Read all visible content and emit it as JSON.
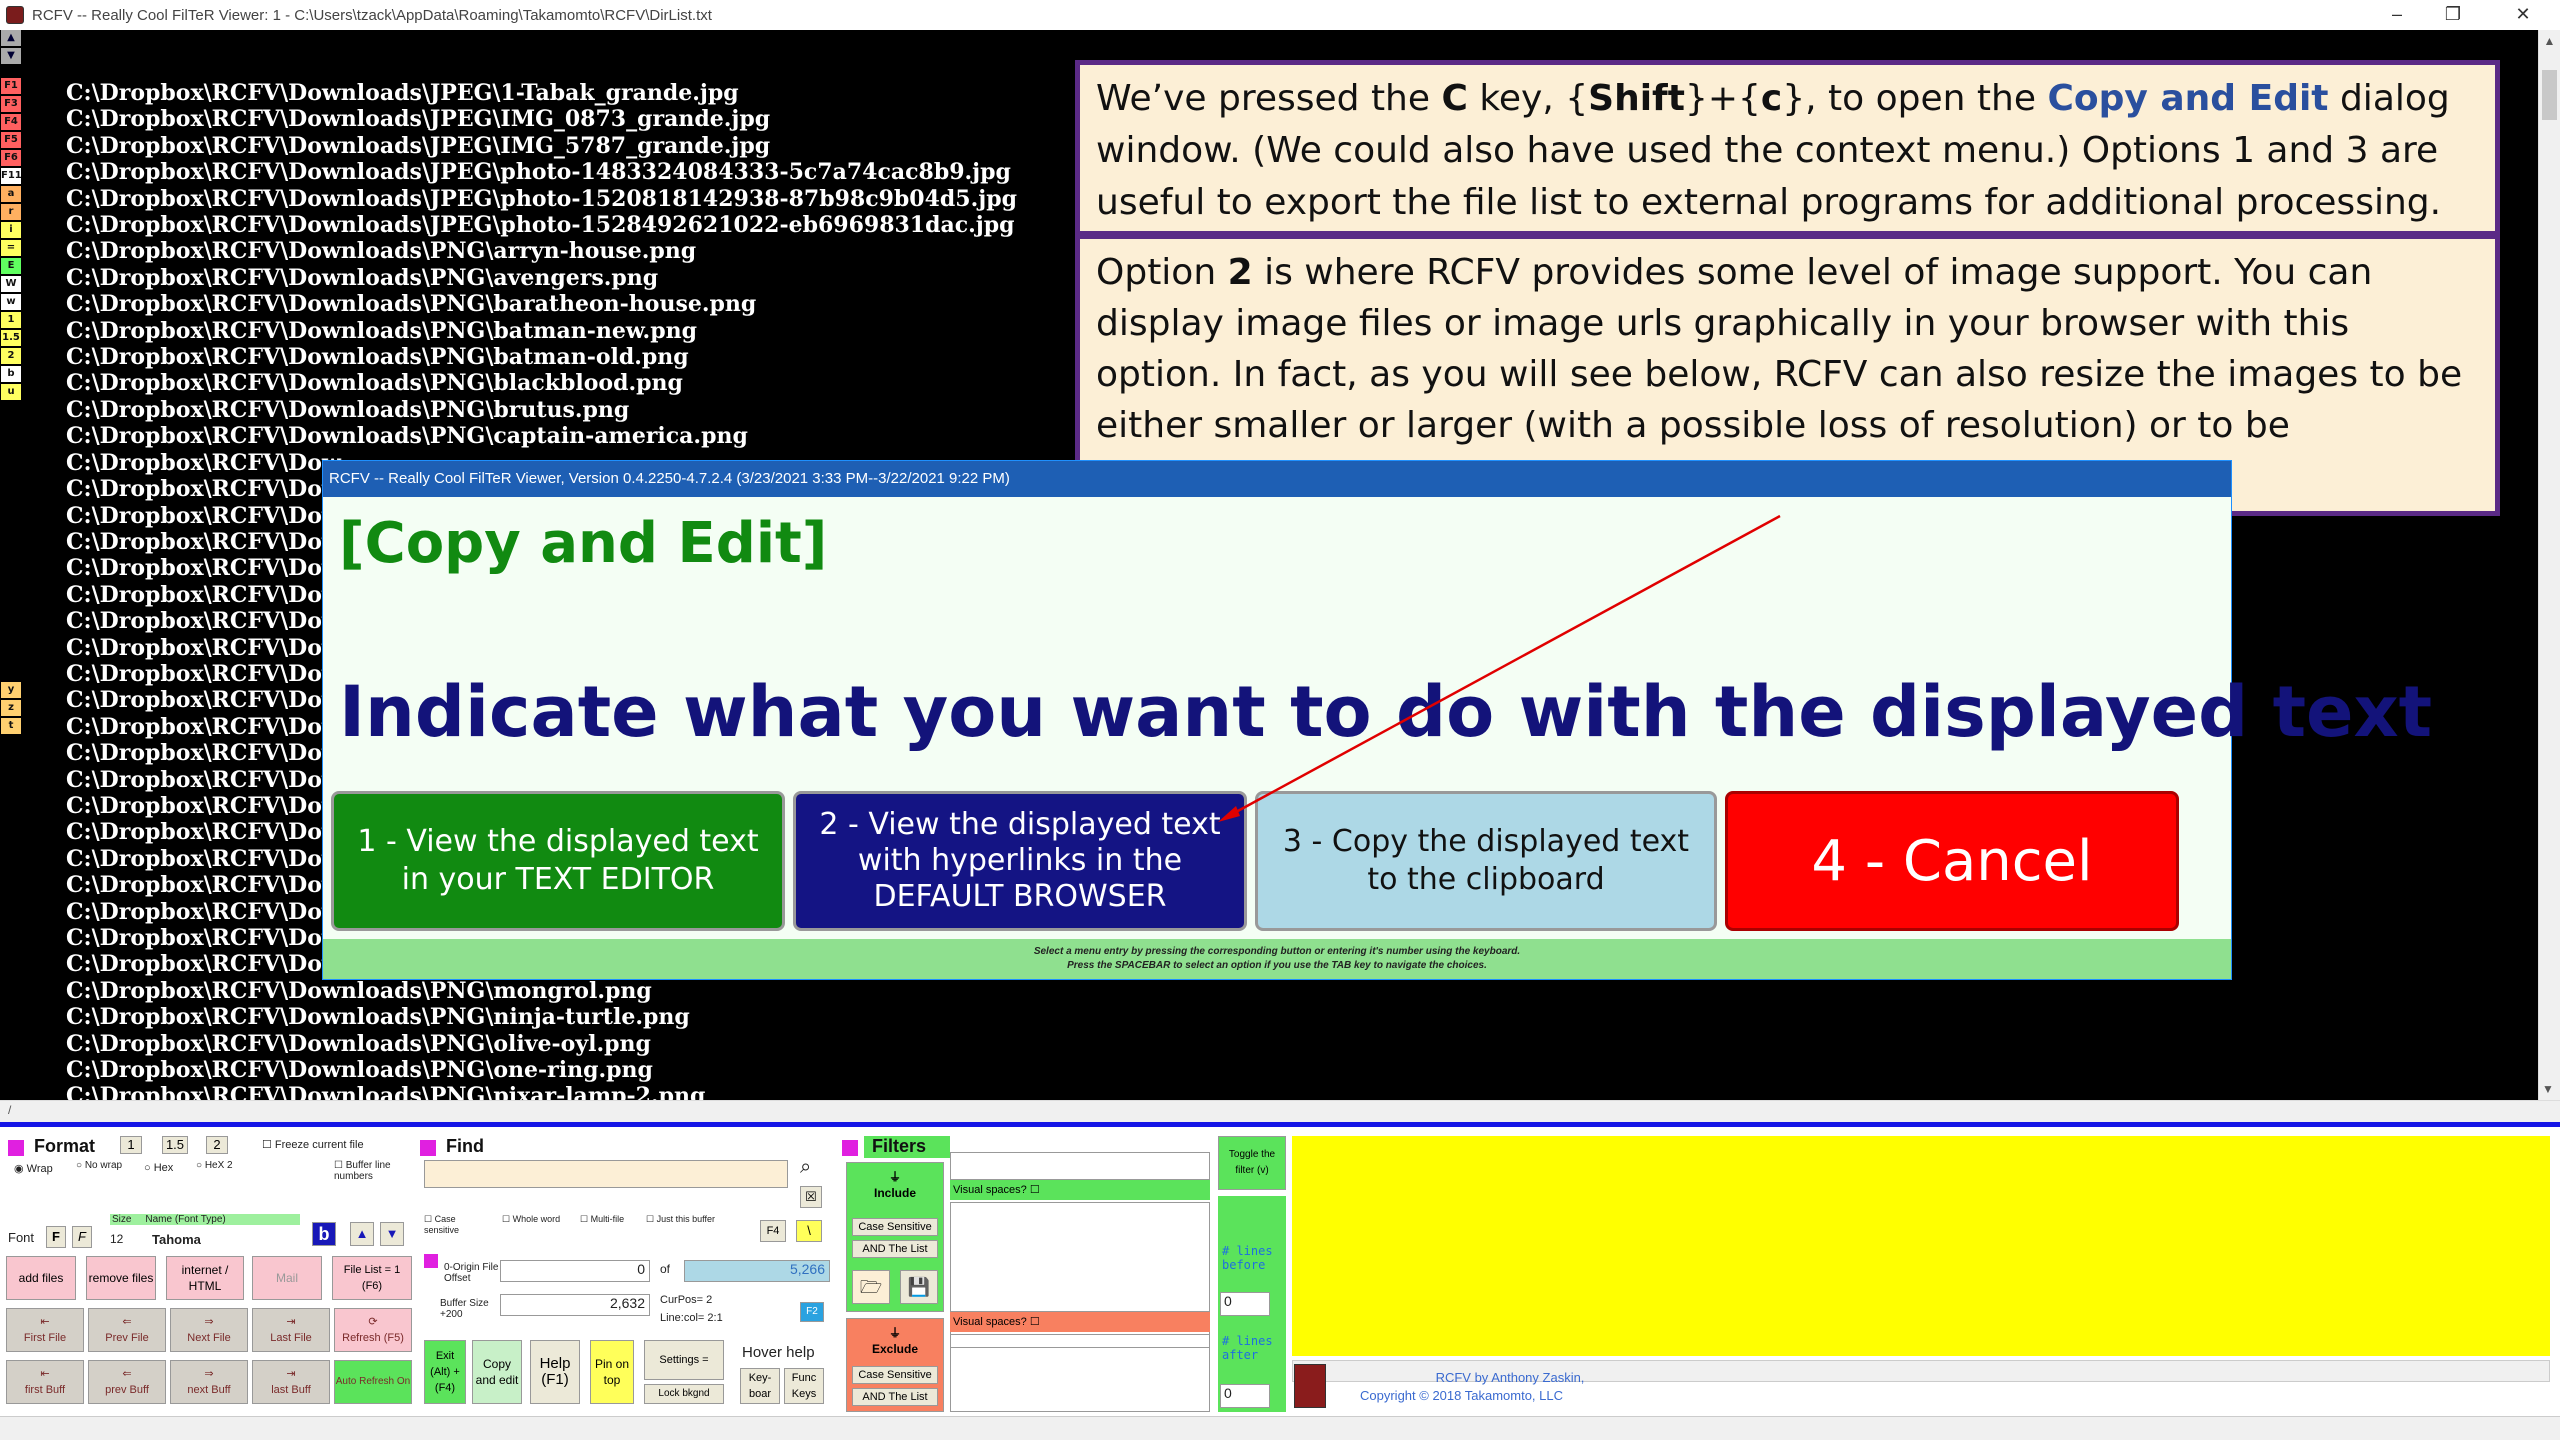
{
  "window": {
    "title": "RCFV -- Really Cool FilTeR Viewer: 1 - C:\\Users\\tzack\\AppData\\Roaming\\Takamomto\\RCFV\\DirList.txt",
    "minimize": "–",
    "restore": "❐",
    "close": "✕"
  },
  "gutter": {
    "marks": [
      {
        "label": "F1",
        "color": "#ff6060"
      },
      {
        "label": "F3",
        "color": "#ff6060"
      },
      {
        "label": "F4",
        "color": "#ff6060"
      },
      {
        "label": "F5",
        "color": "#ff6060"
      },
      {
        "label": "F6",
        "color": "#ff6060"
      },
      {
        "label": "F11",
        "color": "#ffffff"
      },
      {
        "label": "a",
        "color": "#ffb060"
      },
      {
        "label": "r",
        "color": "#ffb060"
      },
      {
        "label": "i",
        "color": "#ffff60"
      },
      {
        "label": "=",
        "color": "#ffff60"
      },
      {
        "label": "E",
        "color": "#60ff60"
      },
      {
        "label": "W",
        "color": "#ffffff"
      },
      {
        "label": "w",
        "color": "#ffffff"
      },
      {
        "label": "1",
        "color": "#ffff60"
      },
      {
        "label": "1.5",
        "color": "#ffff60"
      },
      {
        "label": "2",
        "color": "#ffff60"
      },
      {
        "label": "b",
        "color": "#ffffff"
      },
      {
        "label": "u",
        "color": "#ffff60"
      }
    ],
    "lower_marks": [
      "y",
      "z",
      "t"
    ]
  },
  "lines": [
    "C:\\Dropbox\\RCFV\\Downloads\\JPEG\\1-Tabak_grande.jpg",
    "C:\\Dropbox\\RCFV\\Downloads\\JPEG\\IMG_0873_grande.jpg",
    "C:\\Dropbox\\RCFV\\Downloads\\JPEG\\IMG_5787_grande.jpg",
    "C:\\Dropbox\\RCFV\\Downloads\\JPEG\\photo-1483324084333-5c7a74cac8b9.jpg",
    "C:\\Dropbox\\RCFV\\Downloads\\JPEG\\photo-1520818142938-87b98c9b04d5.jpg",
    "C:\\Dropbox\\RCFV\\Downloads\\JPEG\\photo-1528492621022-eb6969831dac.jpg",
    "C:\\Dropbox\\RCFV\\Downloads\\PNG\\arryn-house.png",
    "C:\\Dropbox\\RCFV\\Downloads\\PNG\\avengers.png",
    "C:\\Dropbox\\RCFV\\Downloads\\PNG\\baratheon-house.png",
    "C:\\Dropbox\\RCFV\\Downloads\\PNG\\batman-new.png",
    "C:\\Dropbox\\RCFV\\Downloads\\PNG\\batman-old.png",
    "C:\\Dropbox\\RCFV\\Downloads\\PNG\\blackblood.png",
    "C:\\Dropbox\\RCFV\\Downloads\\PNG\\brutus.png",
    "C:\\Dropbox\\RCFV\\Downloads\\PNG\\captain-america.png",
    "C:\\Dropbox\\RCFV\\Dow",
    "C:\\Dropbox\\RCFV\\Dow",
    "C:\\Dropbox\\RCFV\\Dow",
    "C:\\Dropbox\\RCFV\\Dow",
    "C:\\Dropbox\\RCFV\\Dow",
    "C:\\Dropbox\\RCFV\\Dow",
    "C:\\Dropbox\\RCFV\\Dow",
    "C:\\Dropbox\\RCFV\\Dow",
    "C:\\Dropbox\\RCFV\\Dow",
    "C:\\Dropbox\\RCFV\\Dow",
    "C:\\Dropbox\\RCFV\\Dow",
    "C:\\Dropbox\\RCFV\\Dow",
    "C:\\Dropbox\\RCFV\\Dow",
    "C:\\Dropbox\\RCFV\\Dow",
    "C:\\Dropbox\\RCFV\\Dow",
    "C:\\Dropbox\\RCFV\\Dow",
    "C:\\Dropbox\\RCFV\\Dow",
    "C:\\Dropbox\\RCFV\\Dow",
    "C:\\Dropbox\\RCFV\\Dow",
    "C:\\Dropbox\\RCFV\\Dow",
    "C:\\Dropbox\\RCFV\\Downloads\\PNG\\mongrol.png",
    "C:\\Dropbox\\RCFV\\Downloads\\PNG\\ninja-turtle.png",
    "C:\\Dropbox\\RCFV\\Downloads\\PNG\\olive-oyl.png",
    "C:\\Dropbox\\RCFV\\Downloads\\PNG\\one-ring.png",
    "C:\\Dropbox\\RCFV\\Downloads\\PNG\\pixar-lamp-2.png"
  ],
  "callout1": {
    "p1": "We’ve pressed the ",
    "k1": "C",
    "p2": " key, {",
    "k2": "Shift",
    "p3": "}+{",
    "k3": "c",
    "p4": "}, to open the ",
    "link": "Copy and Edit",
    "p5": " dialog window. (We could also have used the context menu.)  Options 1 and 3 are useful to export the file list to external programs for additional processing."
  },
  "callout2": {
    "p1": "Option ",
    "k1": "2",
    "p2": " is where RCFV provides some level of image support.  You can display image files or image urls graphically in your browser with this option.  In fact, as you will see below, RCFV can also resize the images to be either smaller or larger (with a possible loss of resolution) or to be constrained within the specified pixel limit."
  },
  "dialog": {
    "title": "RCFV -- Really Cool FilTeR Viewer, Version 0.4.2250-4.7.2.4 (3/23/2021 3:33 PM--3/22/2021 9:22 PM)",
    "heading": "[Copy and Edit]",
    "prompt": "Indicate what you want to do with the displayed text",
    "buttons": {
      "b1": "1 - View the displayed text in your TEXT EDITOR",
      "b2": "2 - View the displayed text with hyperlinks in the DEFAULT BROWSER",
      "b3": "3 - Copy the displayed text to the clipboard",
      "b4": "4 - Cancel"
    },
    "footer1": "Select a menu entry by pressing the corresponding button or entering it's number using the keyboard.",
    "footer2": "Press the SPACEBAR to select an option if you use the TAB key to navigate the choices."
  },
  "panel": {
    "format": {
      "title": "Format",
      "s1": "1",
      "s15": "1.5",
      "s2": "2",
      "freeze": "Freeze current file",
      "wrap": "Wrap",
      "nowrap": "No wrap",
      "hex": "Hex",
      "hex2": "HeX 2",
      "buffer_line": "Buffer line numbers",
      "font_label": "Font",
      "size_label": "Size",
      "font_name_label": "Name (Font Type)",
      "size": "12",
      "font_name": "Tahoma",
      "bold": "b"
    },
    "files": {
      "add": "add files",
      "remove": "remove files",
      "internet": "internet / HTML",
      "mail": "Mail",
      "file_list": "File List = 1 (F6)",
      "first_file": "First File",
      "prev_file": "Prev File",
      "next_file": "Next File",
      "last_file": "Last File",
      "refresh": "Refresh (F5)",
      "first_buff": "first Buff",
      "prev_buff": "prev Buff",
      "next_buff": "next Buff",
      "last_buff": "last Buff",
      "auto_refresh": "Auto Refresh On"
    },
    "find": {
      "title": "Find",
      "case": "Case sensitive",
      "whole": "Whole word",
      "multi": "Multi-file",
      "just": "Just this buffer",
      "f4": "F4",
      "origin_label": "0-Origin File Offset",
      "origin": "0",
      "of": "of",
      "total": "5,266",
      "buffer_label": "Buffer Size +200",
      "buffer": "2,632",
      "curpos_label": "CurPos=",
      "curpos": "2",
      "linecol_label": "Line:col=",
      "linecol": "2:1",
      "f2": "F2"
    },
    "actions": {
      "exit": "Exit (Alt) + (F4)",
      "copy": "Copy and edit",
      "help": "Help (F1)",
      "pin": "Pin on top",
      "settings": "Settings =",
      "lock": "Lock bkgnd",
      "hover": "Hover help",
      "keyboard": "Key-boar",
      "func": "Func Keys"
    },
    "filters": {
      "title": "Filters",
      "include": "Include",
      "exclude": "Exclude",
      "case": "Case Sensitive",
      "andlist": "AND The List",
      "visual": "Visual spaces?",
      "toggle": "Toggle the filter (v)",
      "before": "# lines before",
      "after": "# lines after",
      "before_val": "0",
      "after_val": "0"
    },
    "credit1": "RCFV by Anthony Zaskin,",
    "credit2": "Copyright © 2018 Takamomto, LLC"
  }
}
